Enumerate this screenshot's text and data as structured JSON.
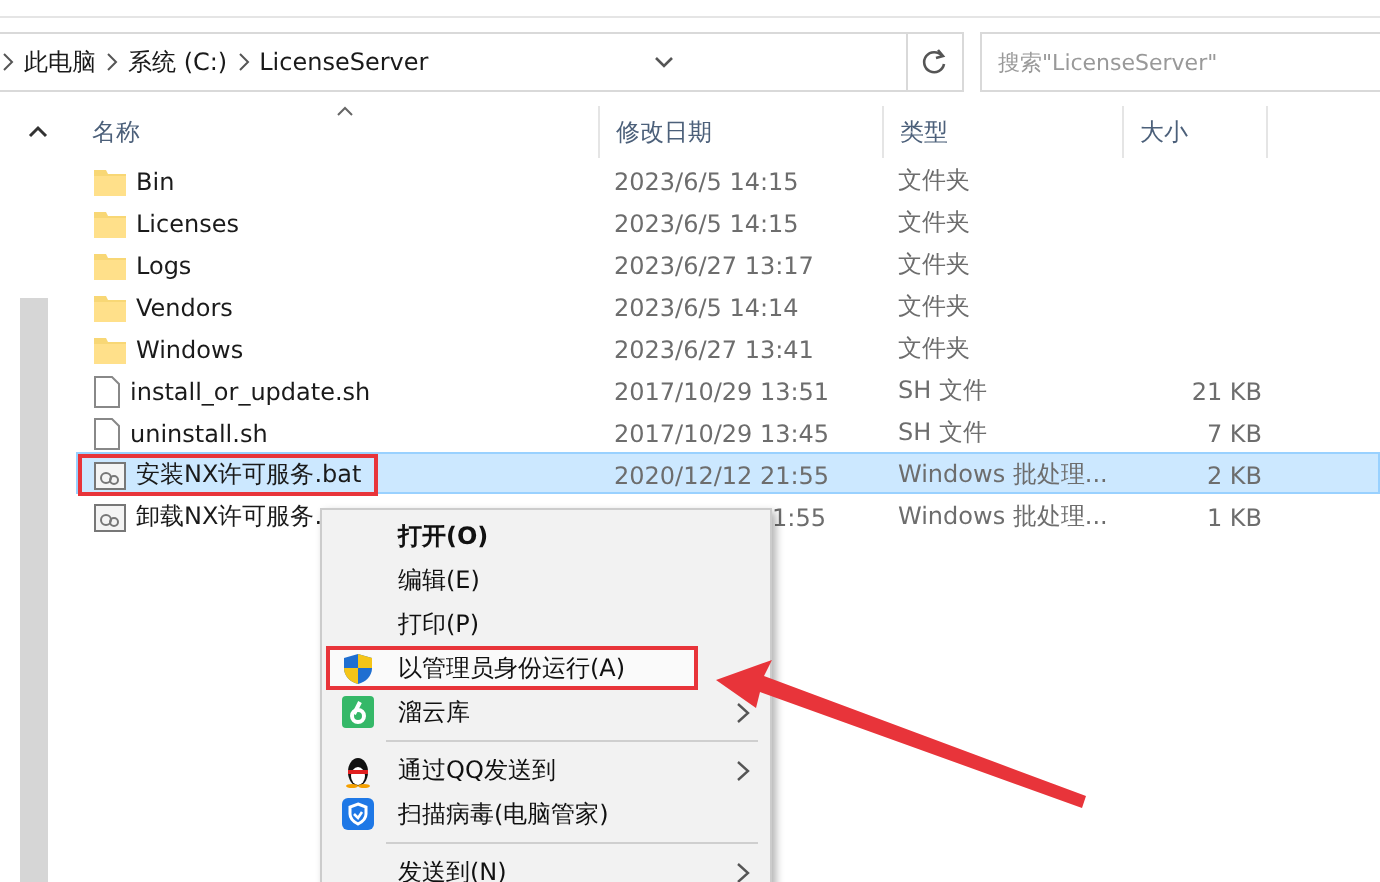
{
  "breadcrumb": [
    "此电脑",
    "系统 (C:)",
    "LicenseServer"
  ],
  "search": {
    "placeholder": "搜索\"LicenseServer\""
  },
  "columns": [
    "名称",
    "修改日期",
    "类型",
    "大小"
  ],
  "rows": [
    {
      "kind": "folder",
      "name": "Bin",
      "date": "2023/6/5 14:15",
      "type": "文件夹",
      "size": "",
      "selected": false,
      "highlighted": false
    },
    {
      "kind": "folder",
      "name": "Licenses",
      "date": "2023/6/5 14:15",
      "type": "文件夹",
      "size": "",
      "selected": false,
      "highlighted": false
    },
    {
      "kind": "folder",
      "name": "Logs",
      "date": "2023/6/27 13:17",
      "type": "文件夹",
      "size": "",
      "selected": false,
      "highlighted": false
    },
    {
      "kind": "folder",
      "name": "Vendors",
      "date": "2023/6/5 14:14",
      "type": "文件夹",
      "size": "",
      "selected": false,
      "highlighted": false
    },
    {
      "kind": "folder",
      "name": "Windows",
      "date": "2023/6/27 13:41",
      "type": "文件夹",
      "size": "",
      "selected": false,
      "highlighted": false
    },
    {
      "kind": "file",
      "name": "install_or_update.sh",
      "date": "2017/10/29 13:51",
      "type": "SH 文件",
      "size": "21 KB",
      "selected": false,
      "highlighted": false
    },
    {
      "kind": "file",
      "name": "uninstall.sh",
      "date": "2017/10/29 13:45",
      "type": "SH 文件",
      "size": "7 KB",
      "selected": false,
      "highlighted": false
    },
    {
      "kind": "batch",
      "name": "安装NX许可服务.bat",
      "date": "2020/12/12 21:55",
      "type": "Windows 批处理...",
      "size": "2 KB",
      "selected": true,
      "highlighted": true
    },
    {
      "kind": "batch",
      "name": "卸载NX许可服务.",
      "date": "1:55",
      "type": "Windows 批处理...",
      "size": "1 KB",
      "selected": false,
      "highlighted": false,
      "date_cut": true
    }
  ],
  "context_menu": [
    {
      "kind": "plain",
      "label": "打开(O)",
      "bold": true,
      "submenu": false,
      "highlighted": false
    },
    {
      "kind": "plain",
      "label": "编辑(E)",
      "bold": false,
      "submenu": false,
      "highlighted": false
    },
    {
      "kind": "plain",
      "label": "打印(P)",
      "bold": false,
      "submenu": false,
      "highlighted": false
    },
    {
      "kind": "admin",
      "label": "以管理员身份运行(A)",
      "bold": false,
      "submenu": false,
      "highlighted": true
    },
    {
      "kind": "cloud",
      "label": "溜云库",
      "bold": false,
      "submenu": true,
      "highlighted": false
    },
    {
      "kind": "separator"
    },
    {
      "kind": "qq",
      "label": "通过QQ发送到",
      "bold": false,
      "submenu": true,
      "highlighted": false
    },
    {
      "kind": "antivirus",
      "label": "扫描病毒(电脑管家)",
      "bold": false,
      "submenu": false,
      "highlighted": false
    },
    {
      "kind": "separator"
    },
    {
      "kind": "plain",
      "label": "发送到(N)",
      "bold": false,
      "submenu": true,
      "highlighted": false
    }
  ]
}
